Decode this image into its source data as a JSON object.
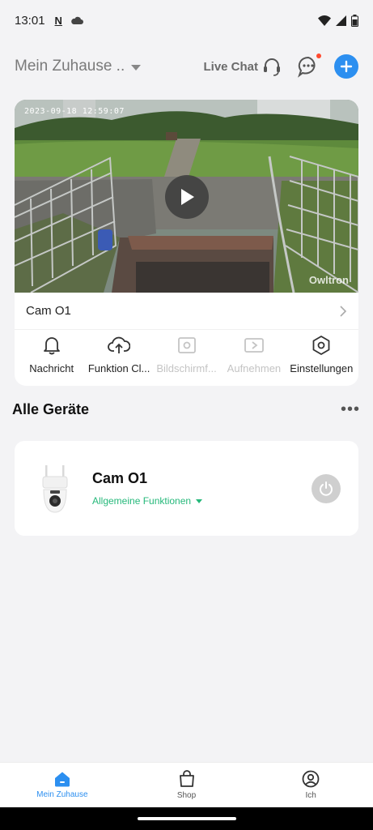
{
  "status_bar": {
    "time": "13:01",
    "icons": [
      "n-icon",
      "cloud-icon",
      "wifi-icon",
      "signal-icon",
      "battery-icon"
    ]
  },
  "header": {
    "home_title": "Mein Zuhause ..",
    "live_chat_label": "Live Chat",
    "accent_color": "#2c8ff0"
  },
  "camera_card": {
    "timestamp": "2023-09-18  12:59:07",
    "brand": "Owltron",
    "name": "Cam O1",
    "actions": [
      {
        "label": "Nachricht",
        "icon": "bell-icon",
        "enabled": true
      },
      {
        "label": "Funktion Cl...",
        "icon": "cloud-upload-icon",
        "enabled": true
      },
      {
        "label": "Bildschirmf...",
        "icon": "screenshot-icon",
        "enabled": false
      },
      {
        "label": "Aufnehmen",
        "icon": "video-record-icon",
        "enabled": false
      },
      {
        "label": "Einstellungen",
        "icon": "settings-hexagon-icon",
        "enabled": true
      }
    ]
  },
  "devices": {
    "section_title": "Alle Geräte",
    "items": [
      {
        "name": "Cam O1",
        "function_label": "Allgemeine Funktionen",
        "function_color": "#25b87a"
      }
    ]
  },
  "bottom_nav": {
    "items": [
      {
        "label": "Mein Zuhause",
        "icon": "home-icon",
        "active": true
      },
      {
        "label": "Shop",
        "icon": "shopping-bag-icon",
        "active": false
      },
      {
        "label": "Ich",
        "icon": "profile-icon",
        "active": false
      }
    ]
  }
}
